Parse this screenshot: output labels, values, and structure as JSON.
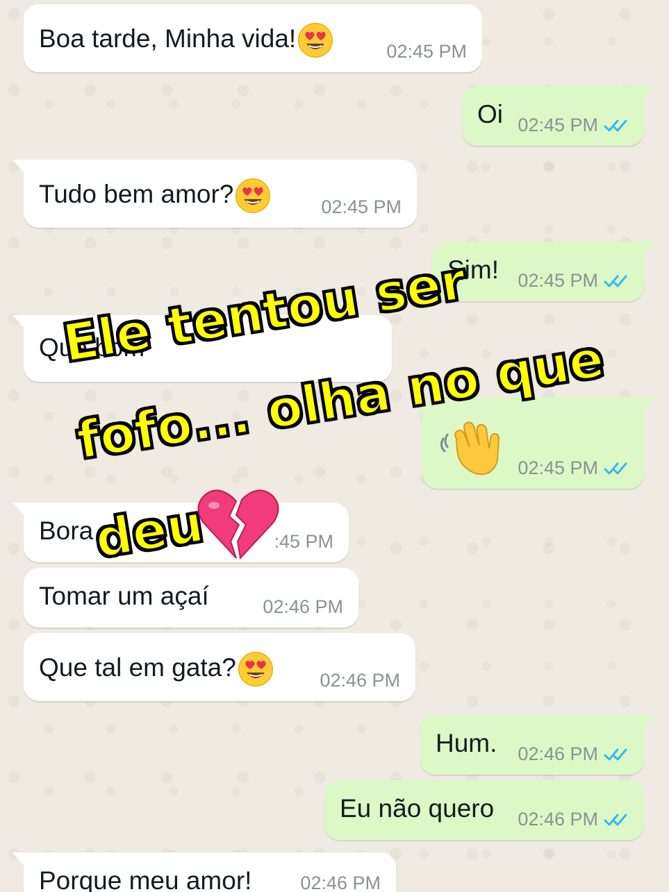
{
  "chat": {
    "messages": [
      {
        "id": "m1",
        "direction": "incoming",
        "text": "Boa tarde, Minha vida!",
        "emoji": "heart-eyes-emoji",
        "time": "02:45 PM"
      },
      {
        "id": "m2",
        "direction": "outgoing",
        "text": "Oi",
        "time": "02:45 PM",
        "status": "read"
      },
      {
        "id": "m3",
        "direction": "incoming",
        "text": "Tudo bem amor?",
        "emoji": "heart-eyes-emoji",
        "time": "02:45 PM"
      },
      {
        "id": "m4",
        "direction": "outgoing",
        "text": "Sim!",
        "time": "02:45 PM",
        "status": "read"
      },
      {
        "id": "m5",
        "direction": "incoming",
        "text": "Que bom",
        "time": ""
      },
      {
        "id": "m6",
        "direction": "outgoing",
        "text": "",
        "emoji": "waving-hand-emoji",
        "time": "02:45 PM",
        "status": "read"
      },
      {
        "id": "m7",
        "direction": "incoming",
        "text": "Bora",
        "time": ":45 PM"
      },
      {
        "id": "m8",
        "direction": "incoming",
        "text": "Tomar um açaí",
        "time": "02:46 PM"
      },
      {
        "id": "m9",
        "direction": "incoming",
        "text": "Que tal em gata?",
        "emoji": "heart-eyes-emoji",
        "time": "02:46 PM"
      },
      {
        "id": "m10",
        "direction": "outgoing",
        "text": "Hum.",
        "time": "02:46 PM",
        "status": "read"
      },
      {
        "id": "m11",
        "direction": "outgoing",
        "text": "Eu não quero",
        "time": "02:46 PM",
        "status": "read"
      },
      {
        "id": "m12",
        "direction": "incoming",
        "text": "Porque meu amor!",
        "time": "02:46 PM"
      }
    ]
  },
  "overlay": {
    "line1": "Ele tentou ser",
    "line2": "fofo... olha no que",
    "line3": "deu",
    "emoji": "broken-heart-emoji"
  },
  "colors": {
    "incoming_bubble": "#ffffff",
    "outgoing_bubble": "#dcf8c6",
    "read_ticks": "#34b7f1",
    "overlay_text": "#ffff00"
  }
}
